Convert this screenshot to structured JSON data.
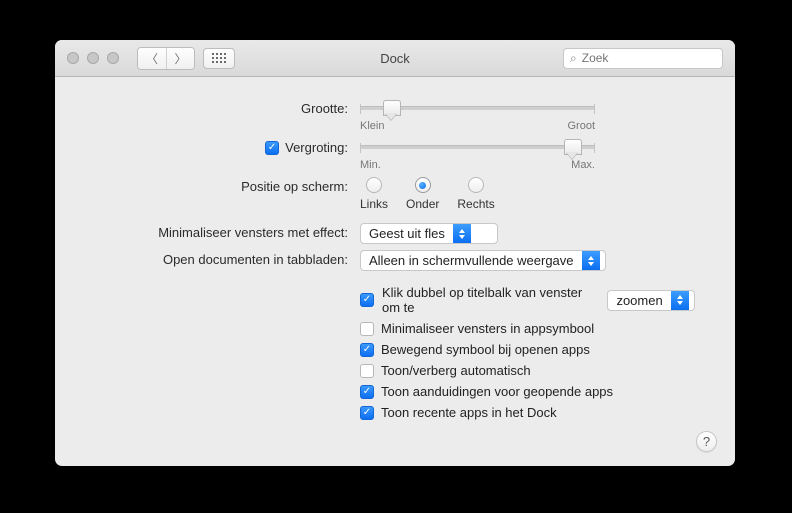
{
  "window": {
    "title": "Dock",
    "search_placeholder": "Zoek"
  },
  "rows": {
    "size": {
      "label": "Grootte:",
      "min_label": "Klein",
      "max_label": "Groot",
      "value_percent": 13
    },
    "magnification": {
      "checked": true,
      "label": "Vergroting:",
      "min_label": "Min.",
      "max_label": "Max.",
      "value_percent": 90
    },
    "position": {
      "label": "Positie op scherm:",
      "options": [
        "Links",
        "Onder",
        "Rechts"
      ],
      "selected_index": 1
    },
    "minimize_effect": {
      "label": "Minimaliseer vensters met effect:",
      "value": "Geest uit fles"
    },
    "open_tabs": {
      "label": "Open documenten in tabbladen:",
      "value": "Alleen in schermvullende weergave"
    }
  },
  "checks": {
    "doubleclick": {
      "checked": true,
      "label": "Klik dubbel op titelbalk van venster om te",
      "action_value": "zoomen"
    },
    "minimize_into_app": {
      "checked": false,
      "label": "Minimaliseer vensters in appsymbool"
    },
    "animate_open": {
      "checked": true,
      "label": "Bewegend symbool bij openen apps"
    },
    "autohide": {
      "checked": false,
      "label": "Toon/verberg automatisch"
    },
    "indicators": {
      "checked": true,
      "label": "Toon aanduidingen voor geopende apps"
    },
    "recent_apps": {
      "checked": true,
      "label": "Toon recente apps in het Dock"
    }
  },
  "help_label": "?"
}
